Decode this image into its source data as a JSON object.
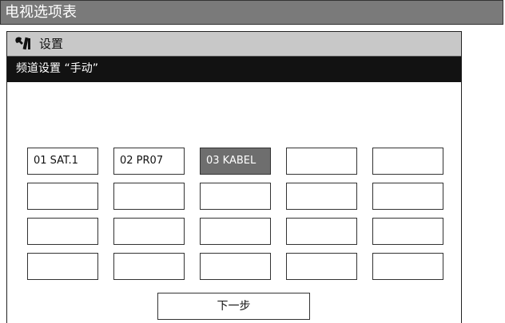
{
  "window": {
    "title": "电视选项表"
  },
  "settings_panel": {
    "icon": "wrench-screwdriver-icon",
    "header_label": "设置",
    "subheader_label": "频道设置 “手动”"
  },
  "channel_grid": {
    "selected_index": 2,
    "rows": [
      [
        "01  SAT.1",
        "02  PR07",
        "03  KABEL",
        "",
        ""
      ],
      [
        "",
        "",
        "",
        "",
        ""
      ],
      [
        "",
        "",
        "",
        "",
        ""
      ],
      [
        "",
        "",
        "",
        "",
        ""
      ]
    ]
  },
  "footer": {
    "next_label": "下一步"
  }
}
